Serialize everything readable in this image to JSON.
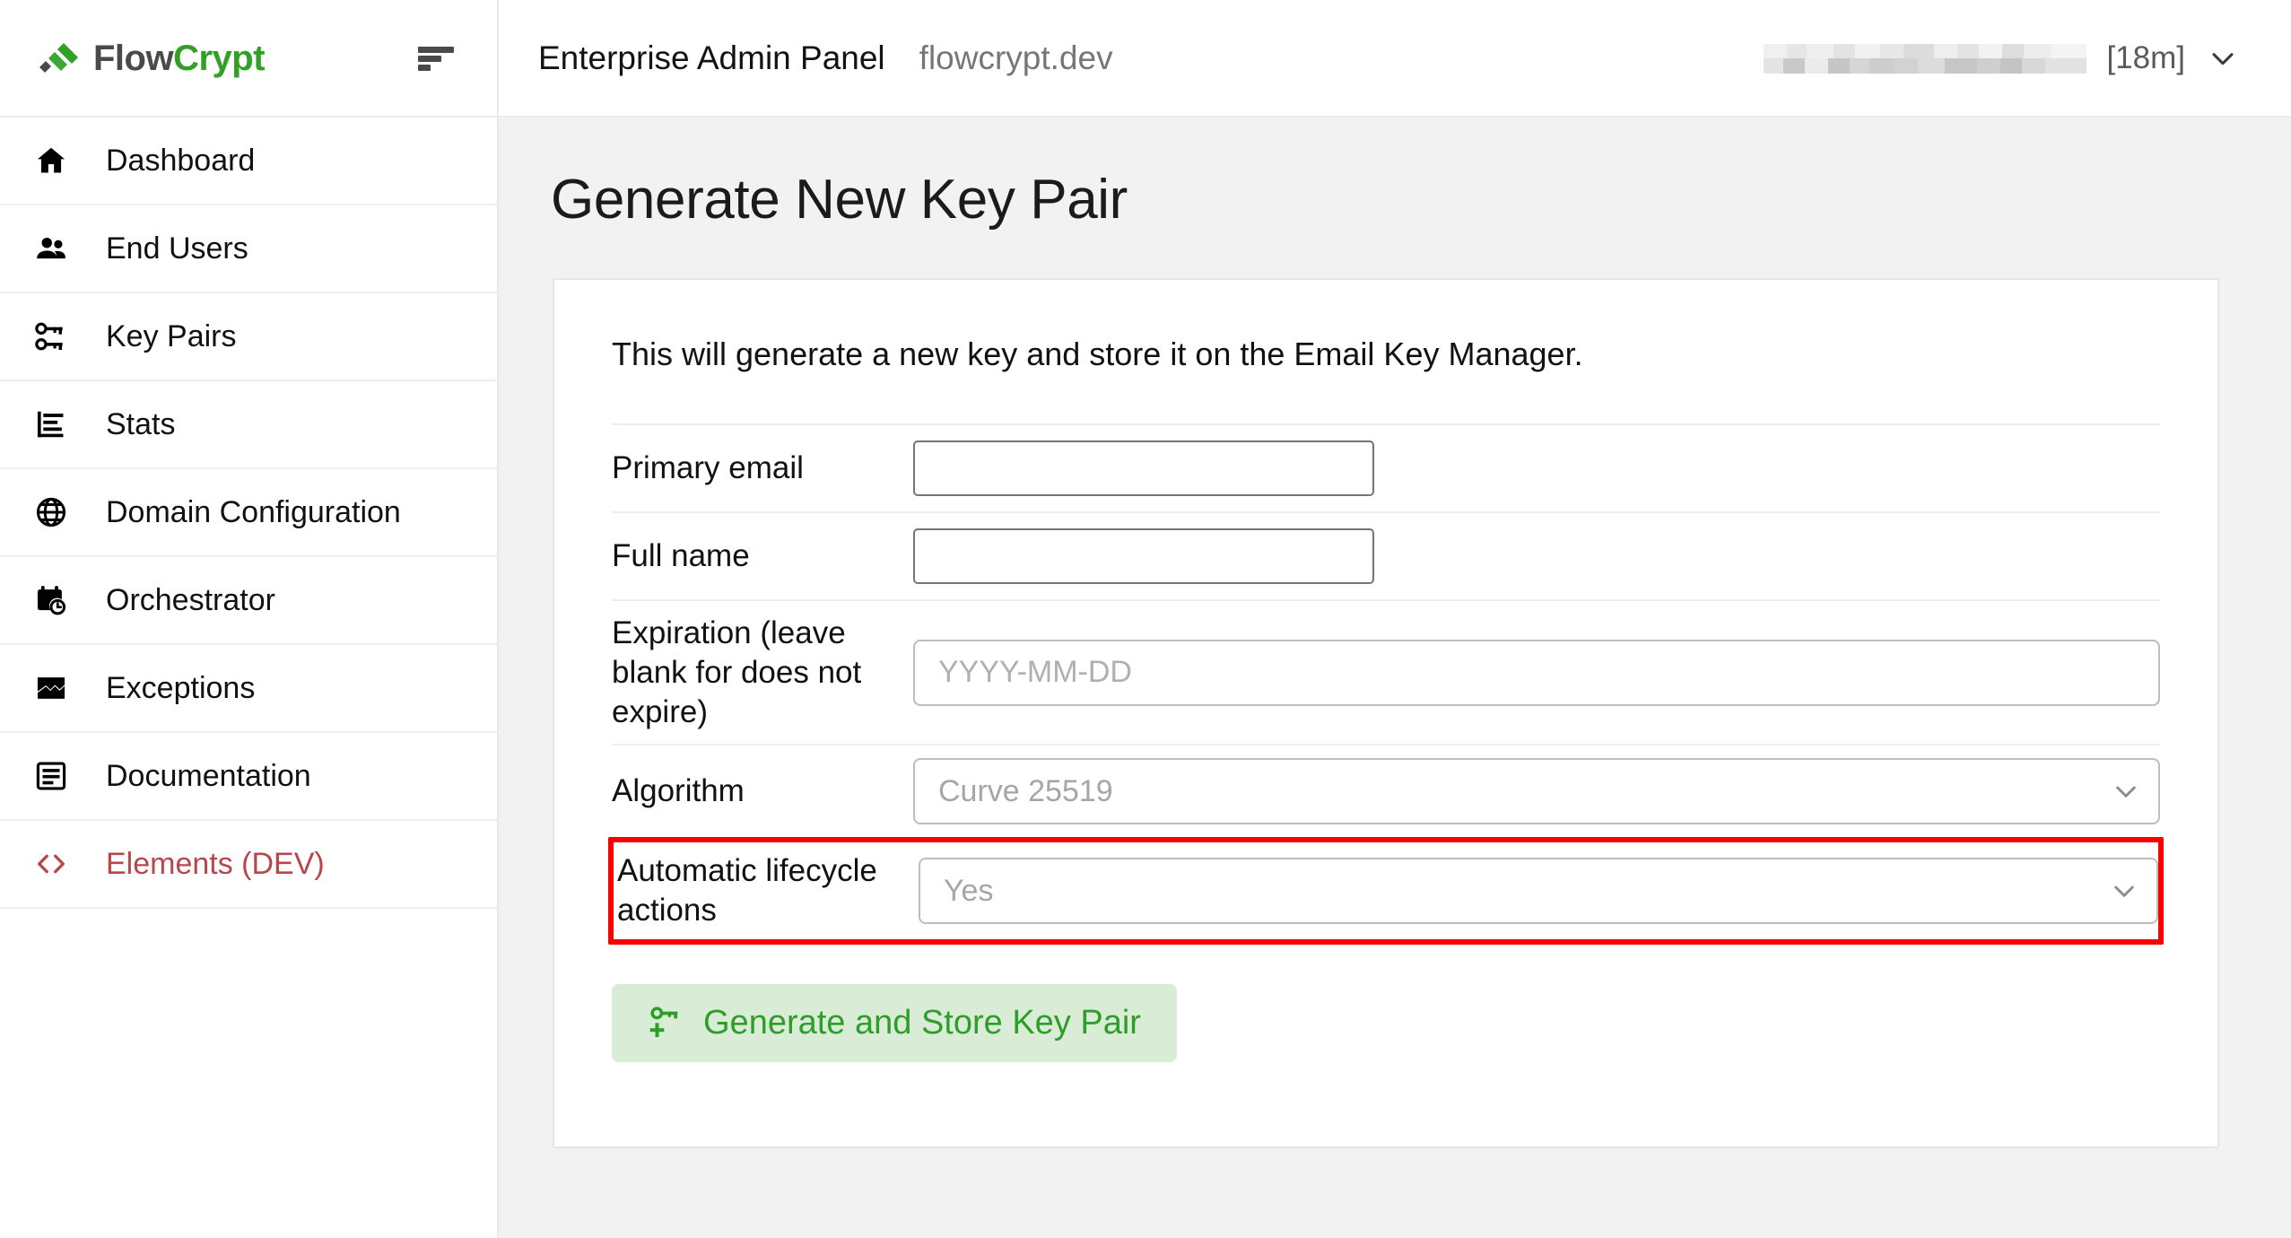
{
  "brand": {
    "name_first": "Flow",
    "name_second": "Crypt",
    "logo_icon": "flowcrypt-logo-icon",
    "sort_icon": "sort-lines-icon",
    "colors": {
      "flow": "#4a4a4a",
      "crypt": "#31a024"
    }
  },
  "sidebar": {
    "items": [
      {
        "label": "Dashboard",
        "icon": "home-icon",
        "active": false
      },
      {
        "label": "End Users",
        "icon": "people-icon",
        "active": false
      },
      {
        "label": "Key Pairs",
        "icon": "key-pairs-icon",
        "active": false
      },
      {
        "label": "Stats",
        "icon": "bar-chart-icon",
        "active": false
      },
      {
        "label": "Domain Configuration",
        "icon": "globe-icon",
        "active": false
      },
      {
        "label": "Orchestrator",
        "icon": "calendar-clock-icon",
        "active": false
      },
      {
        "label": "Exceptions",
        "icon": "broken-image-icon",
        "active": false
      },
      {
        "label": "Documentation",
        "icon": "document-icon",
        "active": false
      },
      {
        "label": "Elements (DEV)",
        "icon": "code-brackets-icon",
        "active": false,
        "dev": true
      }
    ],
    "dev_color": "#b6474a"
  },
  "topbar": {
    "title": "Enterprise Admin Panel",
    "domain": "flowcrypt.dev",
    "user_account_redacted": "",
    "session_remaining": "[18m]",
    "chevron_icon": "chevron-down-icon"
  },
  "page": {
    "title": "Generate New Key Pair"
  },
  "card": {
    "intro": "This will generate a new key and store it on the Email Key Manager.",
    "fields": [
      {
        "label": "Primary email",
        "type": "text",
        "value": "",
        "placeholder": ""
      },
      {
        "label": "Full name",
        "type": "text",
        "value": "",
        "placeholder": ""
      },
      {
        "label": "Expiration (leave blank for does not expire)",
        "type": "text-wide",
        "value": "",
        "placeholder": "YYYY-MM-DD"
      },
      {
        "label": "Algorithm",
        "type": "select",
        "value": "Curve 25519"
      },
      {
        "label": "Automatic lifecycle actions",
        "type": "select",
        "value": "Yes",
        "highlighted": true
      }
    ],
    "submit": {
      "label": "Generate and Store Key Pair",
      "icon": "key-plus-icon"
    }
  },
  "highlight": {
    "color": "#fb0000"
  }
}
